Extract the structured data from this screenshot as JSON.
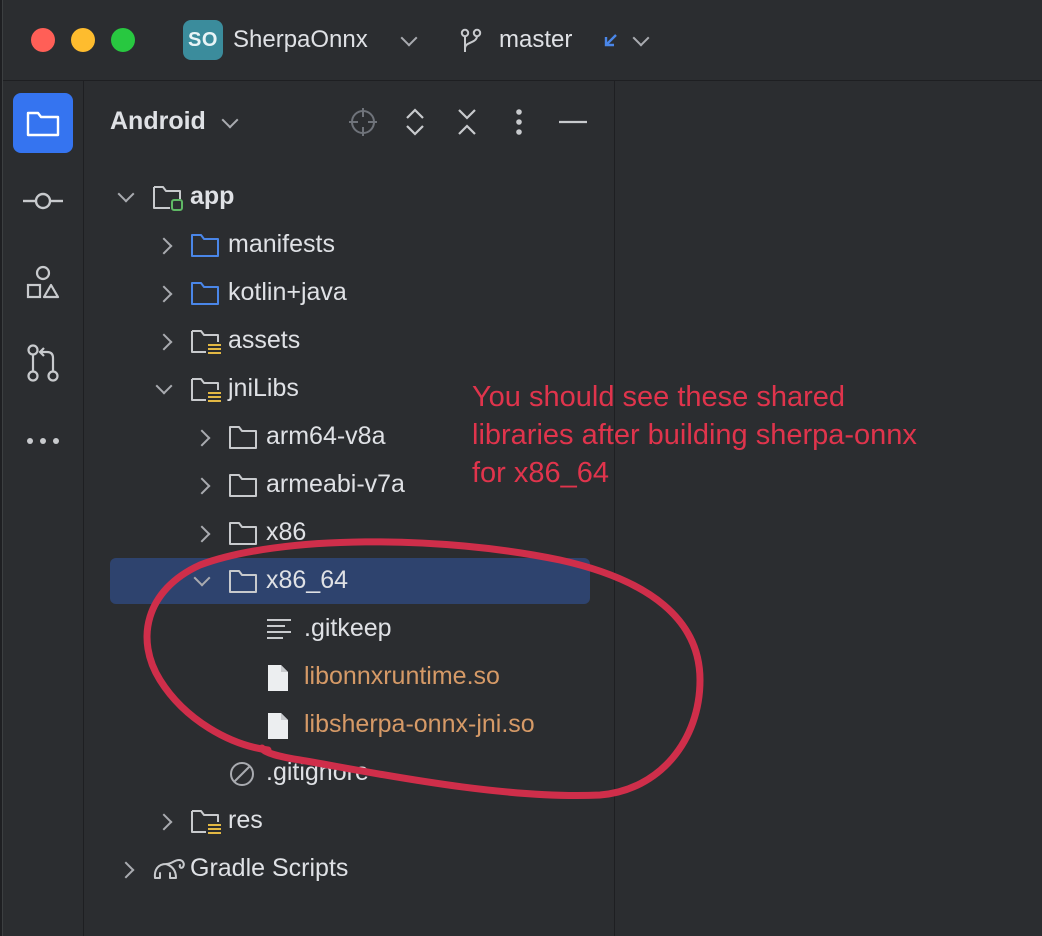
{
  "titlebar": {
    "project_badge": "SO",
    "project_name": "SherpaOnnx",
    "branch_name": "master",
    "branch_icon": "branch-icon",
    "incoming_icon": "incoming-arrow-icon"
  },
  "toolstrip": {
    "items": [
      "project-folder-icon",
      "commit-icon",
      "structure-icon",
      "pull-requests-icon",
      "more-icon"
    ]
  },
  "panel": {
    "title": "Android",
    "buttons": [
      "locate-icon",
      "expand-all-icon",
      "collapse-all-icon",
      "more-options-icon",
      "hide-icon"
    ]
  },
  "tree": [
    {
      "label": "app",
      "indent": 0,
      "arrow": "down",
      "icon": "module-folder",
      "bold": true
    },
    {
      "label": "manifests",
      "indent": 1,
      "arrow": "right",
      "icon": "blue-folder"
    },
    {
      "label": "kotlin+java",
      "indent": 1,
      "arrow": "right",
      "icon": "blue-folder"
    },
    {
      "label": "assets",
      "indent": 1,
      "arrow": "right",
      "icon": "resource-folder"
    },
    {
      "label": "jniLibs",
      "indent": 1,
      "arrow": "down",
      "icon": "resource-folder"
    },
    {
      "label": "arm64-v8a",
      "indent": 2,
      "arrow": "right",
      "icon": "folder"
    },
    {
      "label": "armeabi-v7a",
      "indent": 2,
      "arrow": "right",
      "icon": "folder"
    },
    {
      "label": "x86",
      "indent": 2,
      "arrow": "right",
      "icon": "folder"
    },
    {
      "label": "x86_64",
      "indent": 2,
      "arrow": "down",
      "icon": "folder",
      "selected": true
    },
    {
      "label": ".gitkeep",
      "indent": 3,
      "arrow": "none",
      "icon": "text-file"
    },
    {
      "label": "libonnxruntime.so",
      "indent": 3,
      "arrow": "none",
      "icon": "file",
      "orange": true
    },
    {
      "label": "libsherpa-onnx-jni.so",
      "indent": 3,
      "arrow": "none",
      "icon": "file",
      "orange": true
    },
    {
      "label": ".gitignore",
      "indent": 2,
      "arrow": "none",
      "icon": "ignored-file"
    },
    {
      "label": "res",
      "indent": 1,
      "arrow": "right",
      "icon": "resource-folder"
    },
    {
      "label": "Gradle Scripts",
      "indent": 0,
      "arrow": "right",
      "icon": "gradle-elephant"
    }
  ],
  "annotation": {
    "text": "You should see these shared libraries after building sherpa-onnx for x86_64",
    "color": "#e0344c"
  },
  "colors": {
    "accent": "#3574f0",
    "selection": "#2e436e",
    "orange_file": "#d69a67",
    "folder_blue": "#4a86e8"
  }
}
